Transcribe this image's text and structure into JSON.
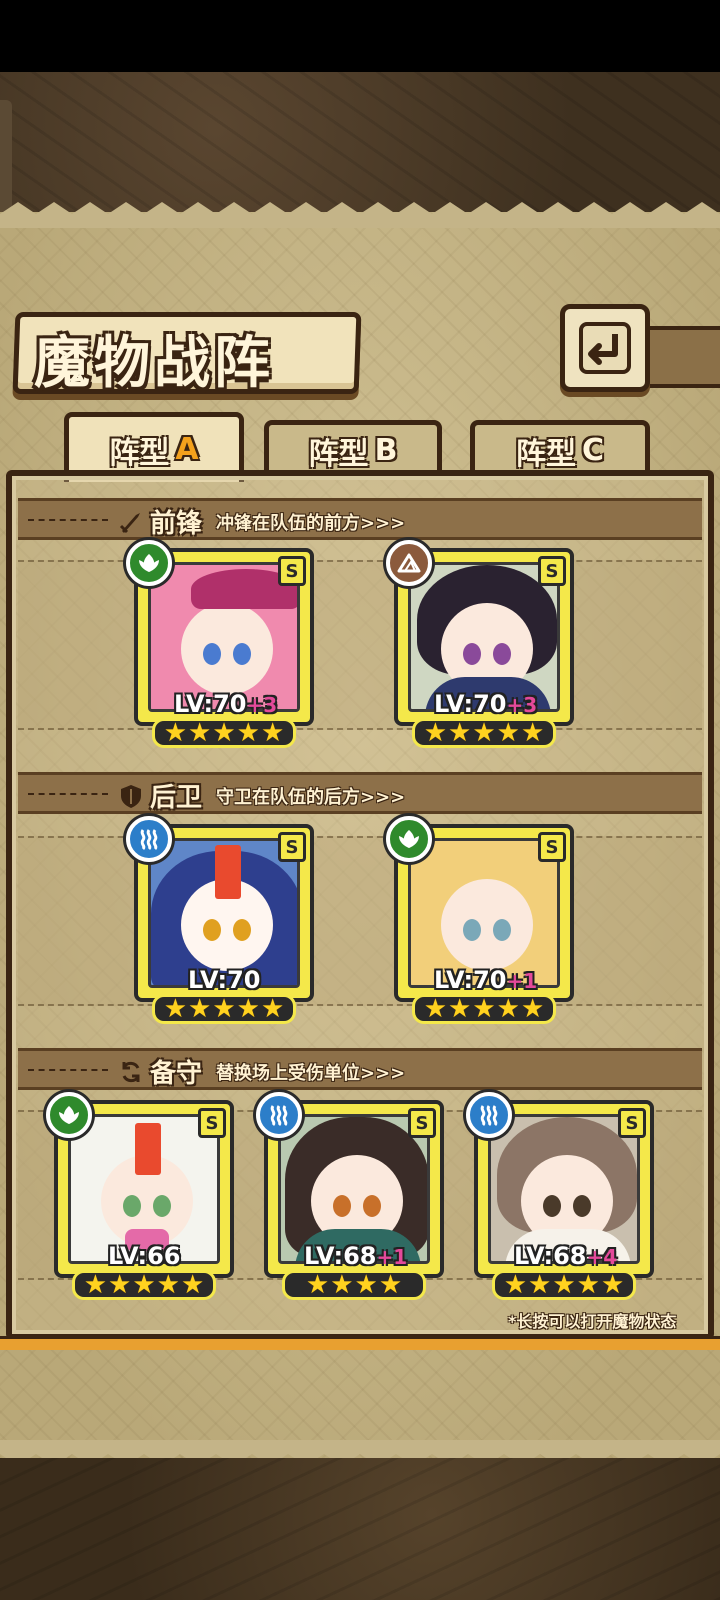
{
  "title": "魔物战阵",
  "back_icon": "back-arrow-icon",
  "tabs": [
    {
      "label": "阵型",
      "letter": "A",
      "active": true
    },
    {
      "label": "阵型",
      "letter": "B",
      "active": false
    },
    {
      "label": "阵型",
      "letter": "C",
      "active": false
    }
  ],
  "sections": {
    "front": {
      "name": "前锋",
      "desc": "冲锋在队伍的前方>>>",
      "icon": "sword-icon"
    },
    "rear": {
      "name": "后卫",
      "desc": "守卫在队伍的后方>>>",
      "icon": "shield-icon"
    },
    "reserve": {
      "name": "备守",
      "desc": "替换场上受伤单位>>>",
      "icon": "swap-icon"
    }
  },
  "cards": {
    "f1": {
      "grade": "S",
      "element": "leaf-element-icon",
      "lv": "LV:70",
      "plus": "+3",
      "stars": 5
    },
    "f2": {
      "grade": "S",
      "element": "rock-element-icon",
      "lv": "LV:70",
      "plus": "+3",
      "stars": 5
    },
    "r1": {
      "grade": "S",
      "element": "water-element-icon",
      "lv": "LV:70",
      "plus": "",
      "stars": 5
    },
    "r2": {
      "grade": "S",
      "element": "leaf-element-icon",
      "lv": "LV:70",
      "plus": "+1",
      "stars": 5
    },
    "b1": {
      "grade": "S",
      "element": "leaf-element-icon",
      "lv": "LV:66",
      "plus": "",
      "stars": 5
    },
    "b2": {
      "grade": "S",
      "element": "water-element-icon",
      "lv": "LV:68",
      "plus": "+1",
      "stars": 4
    },
    "b3": {
      "grade": "S",
      "element": "water-element-icon",
      "lv": "LV:68",
      "plus": "+4",
      "stars": 5
    }
  },
  "hint": "*长按可以打开魔物状态",
  "colors": {
    "frame": "#f4e84a",
    "accent": "#f3a11c",
    "plus": "#e4499a",
    "leaf": "#2f8a2c",
    "water": "#2c7ec9",
    "rock": "#8b5a3c"
  }
}
